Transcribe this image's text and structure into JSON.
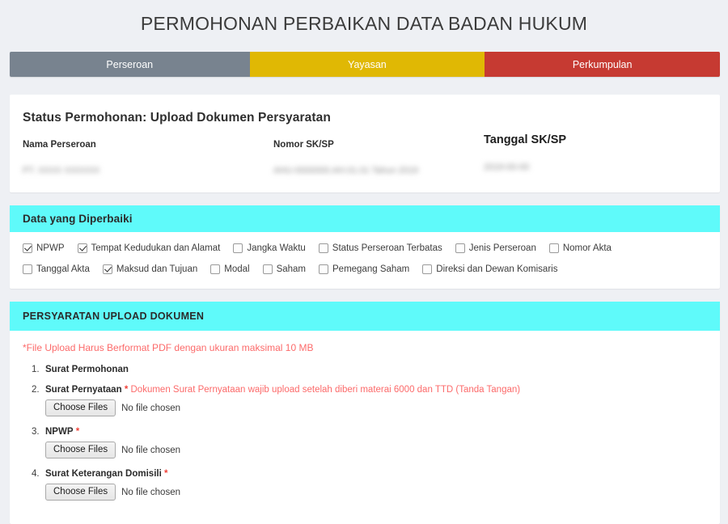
{
  "page": {
    "title": "PERMOHONAN PERBAIKAN DATA BADAN HUKUM",
    "background_color": "#eef0f4"
  },
  "tabs": [
    {
      "label": "Perseroan",
      "color": "#78838f",
      "active": true
    },
    {
      "label": "Yayasan",
      "color": "#e0b804",
      "active": false
    },
    {
      "label": "Perkumpulan",
      "color": "#c63a32",
      "active": false
    }
  ],
  "status": {
    "heading": "Status Permohonan: Upload Dokumen Persyaratan",
    "fields": [
      {
        "label": "Nama Perseroan",
        "value": "PT. XXXX XXXXXX",
        "redacted": true
      },
      {
        "label": "Nomor SK/SP",
        "value": "AHU-0000000.AH.01.01 Tahun 2019",
        "redacted": true
      },
      {
        "label": "Tanggal SK/SP",
        "value": "2019-00-00",
        "redacted": true
      }
    ]
  },
  "data_diperbaiki": {
    "header": "Data yang Diperbaiki",
    "header_color": "#5ffafa",
    "rows": [
      [
        {
          "label": "NPWP",
          "checked": true
        },
        {
          "label": "Tempat Kedudukan dan Alamat",
          "checked": true
        },
        {
          "label": "Jangka Waktu",
          "checked": false
        },
        {
          "label": "Status Perseroan Terbatas",
          "checked": false
        },
        {
          "label": "Jenis Perseroan",
          "checked": false
        },
        {
          "label": "Nomor Akta",
          "checked": false
        }
      ],
      [
        {
          "label": "Tanggal Akta",
          "checked": false
        },
        {
          "label": "Maksud dan Tujuan",
          "checked": true
        },
        {
          "label": "Modal",
          "checked": false
        },
        {
          "label": "Saham",
          "checked": false
        },
        {
          "label": "Pemegang Saham",
          "checked": false
        },
        {
          "label": "Direksi dan Dewan Komisaris",
          "checked": false
        }
      ]
    ]
  },
  "persyaratan": {
    "header": "PERSYARATAN UPLOAD DOKUMEN",
    "header_color": "#5ffafa",
    "notice": "*File Upload Harus Berformat PDF dengan ukuran maksimal 10 MB",
    "notice_color": "#fc6a6a",
    "choose_label": "Choose Files",
    "no_file_label": "No file chosen",
    "documents": [
      {
        "title": "Surat Permohonan",
        "required": false,
        "hint": "",
        "has_upload": false
      },
      {
        "title": "Surat Pernyataan",
        "required": true,
        "hint": "Dokumen Surat Pernyataan wajib upload setelah diberi materai 6000 dan TTD (Tanda Tangan)",
        "has_upload": true
      },
      {
        "title": "NPWP",
        "required": true,
        "hint": "",
        "has_upload": true
      },
      {
        "title": "Surat Keterangan Domisili",
        "required": true,
        "hint": "",
        "has_upload": true
      }
    ]
  }
}
